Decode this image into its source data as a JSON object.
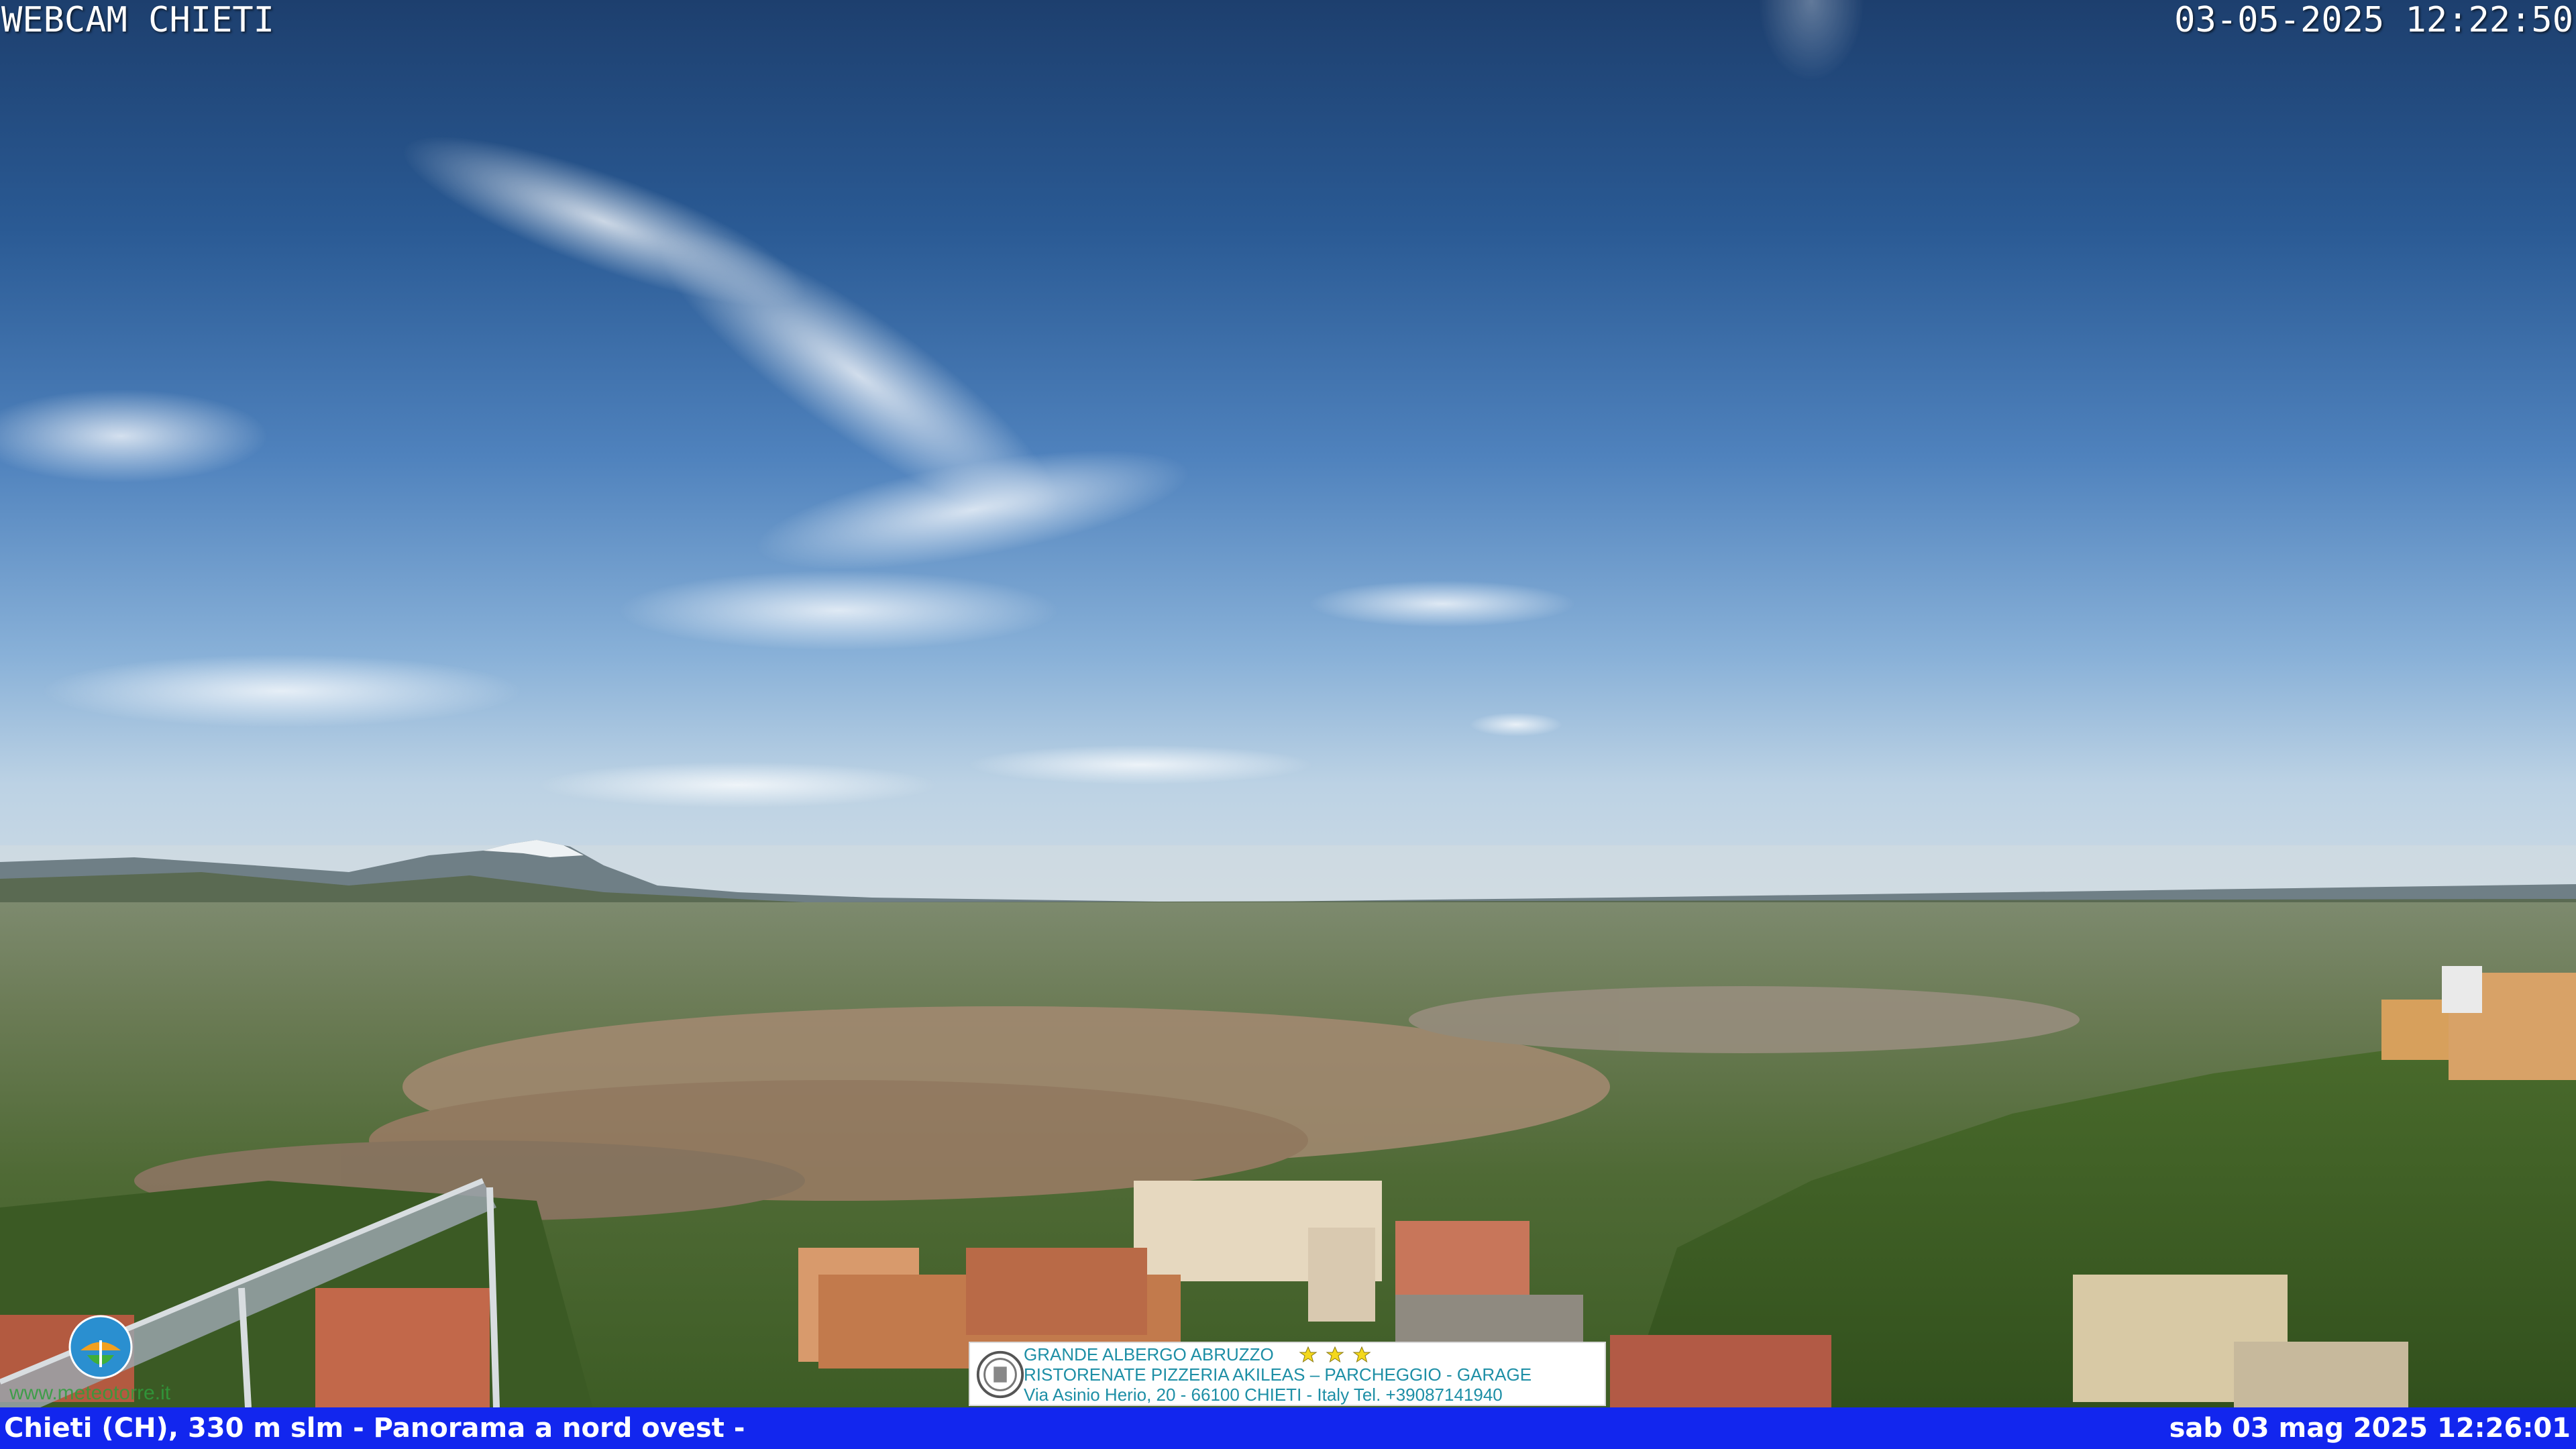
{
  "overlay": {
    "title": "WEBCAM CHIETI",
    "capture_datetime": "03-05-2025 12:22:50"
  },
  "footer": {
    "caption": "Chieti (CH), 330 m slm - Panorama a nord ovest -",
    "datetime": "sab 03 mag 2025 12:26:01",
    "bar_color": "#1226ee"
  },
  "ad_banner": {
    "line1": "GRANDE ALBERGO ABRUZZO",
    "line2": "RISTORENATE PIZZERIA AKILEAS – PARCHEGGIO - GARAGE",
    "line3": "Via Asinio Herio, 20 - 66100 CHIETI - Italy Tel. +39087141940",
    "stars": 3,
    "text_color": "#1e8fa6"
  },
  "watermark": {
    "url": "www.meteotorre.it"
  }
}
